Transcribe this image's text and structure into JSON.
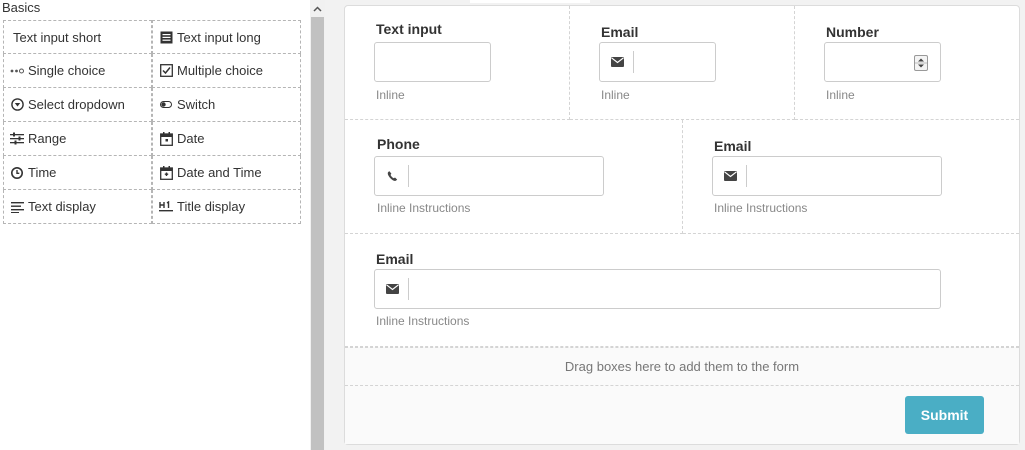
{
  "palette": {
    "title": "Basics",
    "items": [
      {
        "label": "Text input short",
        "icon": "none"
      },
      {
        "label": "Text input long",
        "icon": "text-long-icon"
      },
      {
        "label": "Single choice",
        "icon": "radio-dots-icon"
      },
      {
        "label": "Multiple choice",
        "icon": "checkbox-icon"
      },
      {
        "label": "Select dropdown",
        "icon": "dropdown-circle-icon"
      },
      {
        "label": "Switch",
        "icon": "toggle-icon"
      },
      {
        "label": "Range",
        "icon": "sliders-icon"
      },
      {
        "label": "Date",
        "icon": "calendar-icon"
      },
      {
        "label": "Time",
        "icon": "clock-icon"
      },
      {
        "label": "Date and Time",
        "icon": "calendar-clock-icon"
      },
      {
        "label": "Text display",
        "icon": "text-lines-icon"
      },
      {
        "label": "Title display",
        "icon": "heading-icon"
      }
    ]
  },
  "form": {
    "row1": {
      "text_input": {
        "label": "Text input",
        "help": "Inline"
      },
      "email": {
        "label": "Email",
        "help": "Inline",
        "icon": "envelope-icon"
      },
      "number": {
        "label": "Number",
        "help": "Inline"
      }
    },
    "row2": {
      "phone": {
        "label": "Phone",
        "help": "Inline Instructions",
        "icon": "phone-icon"
      },
      "email": {
        "label": "Email",
        "help": "Inline Instructions",
        "icon": "envelope-icon"
      }
    },
    "row3": {
      "email": {
        "label": "Email",
        "help": "Inline Instructions",
        "icon": "envelope-icon"
      }
    },
    "drop_zone_text": "Drag boxes here to add them to the form",
    "submit_label": "Submit"
  },
  "colors": {
    "accent": "#4aaec5",
    "canvas_bg": "#f2f2f2",
    "dashed_border": "#d4d4d4"
  }
}
